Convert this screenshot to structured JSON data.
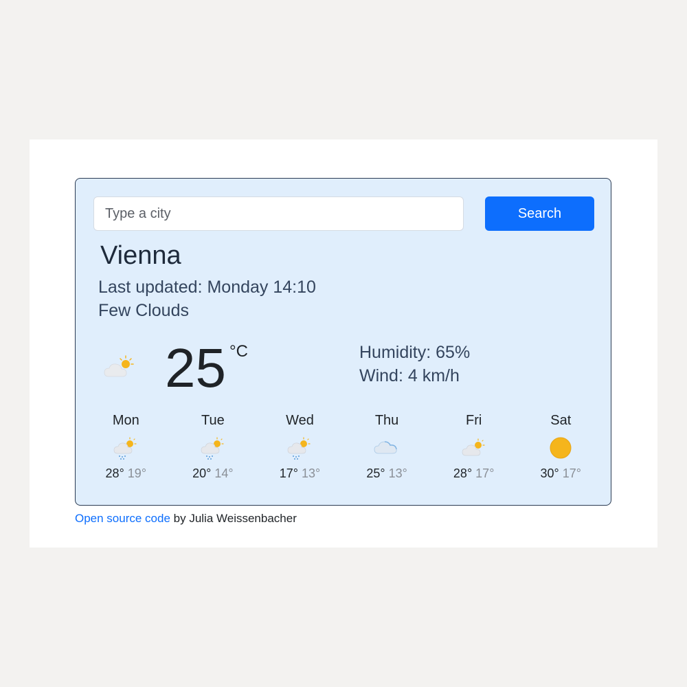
{
  "search": {
    "placeholder": "Type a city",
    "button_label": "Search"
  },
  "current": {
    "city": "Vienna",
    "last_updated": "Last updated: Monday 14:10",
    "description": "Few Clouds",
    "icon": "sun-cloud-icon",
    "temperature": "25",
    "unit": "°C",
    "humidity": "Humidity: 65%",
    "wind": "Wind: 4 km/h"
  },
  "forecast": [
    {
      "day": "Mon",
      "icon": "sun-cloud-rain-icon",
      "max": "28°",
      "min": "19°"
    },
    {
      "day": "Tue",
      "icon": "sun-cloud-rain-icon",
      "max": "20°",
      "min": "14°"
    },
    {
      "day": "Wed",
      "icon": "sun-cloud-rain-icon",
      "max": "17°",
      "min": "13°"
    },
    {
      "day": "Thu",
      "icon": "cloud-icon",
      "max": "25°",
      "min": "13°"
    },
    {
      "day": "Fri",
      "icon": "sun-cloud-icon",
      "max": "28°",
      "min": "17°"
    },
    {
      "day": "Sat",
      "icon": "sun-icon",
      "max": "30°",
      "min": "17°"
    }
  ],
  "footer": {
    "link_text": "Open source code",
    "credit": " by Julia Weissenbacher"
  },
  "colors": {
    "accent": "#0d6efd",
    "card_background": "#e0eefc",
    "sun": "#f5b51c"
  }
}
